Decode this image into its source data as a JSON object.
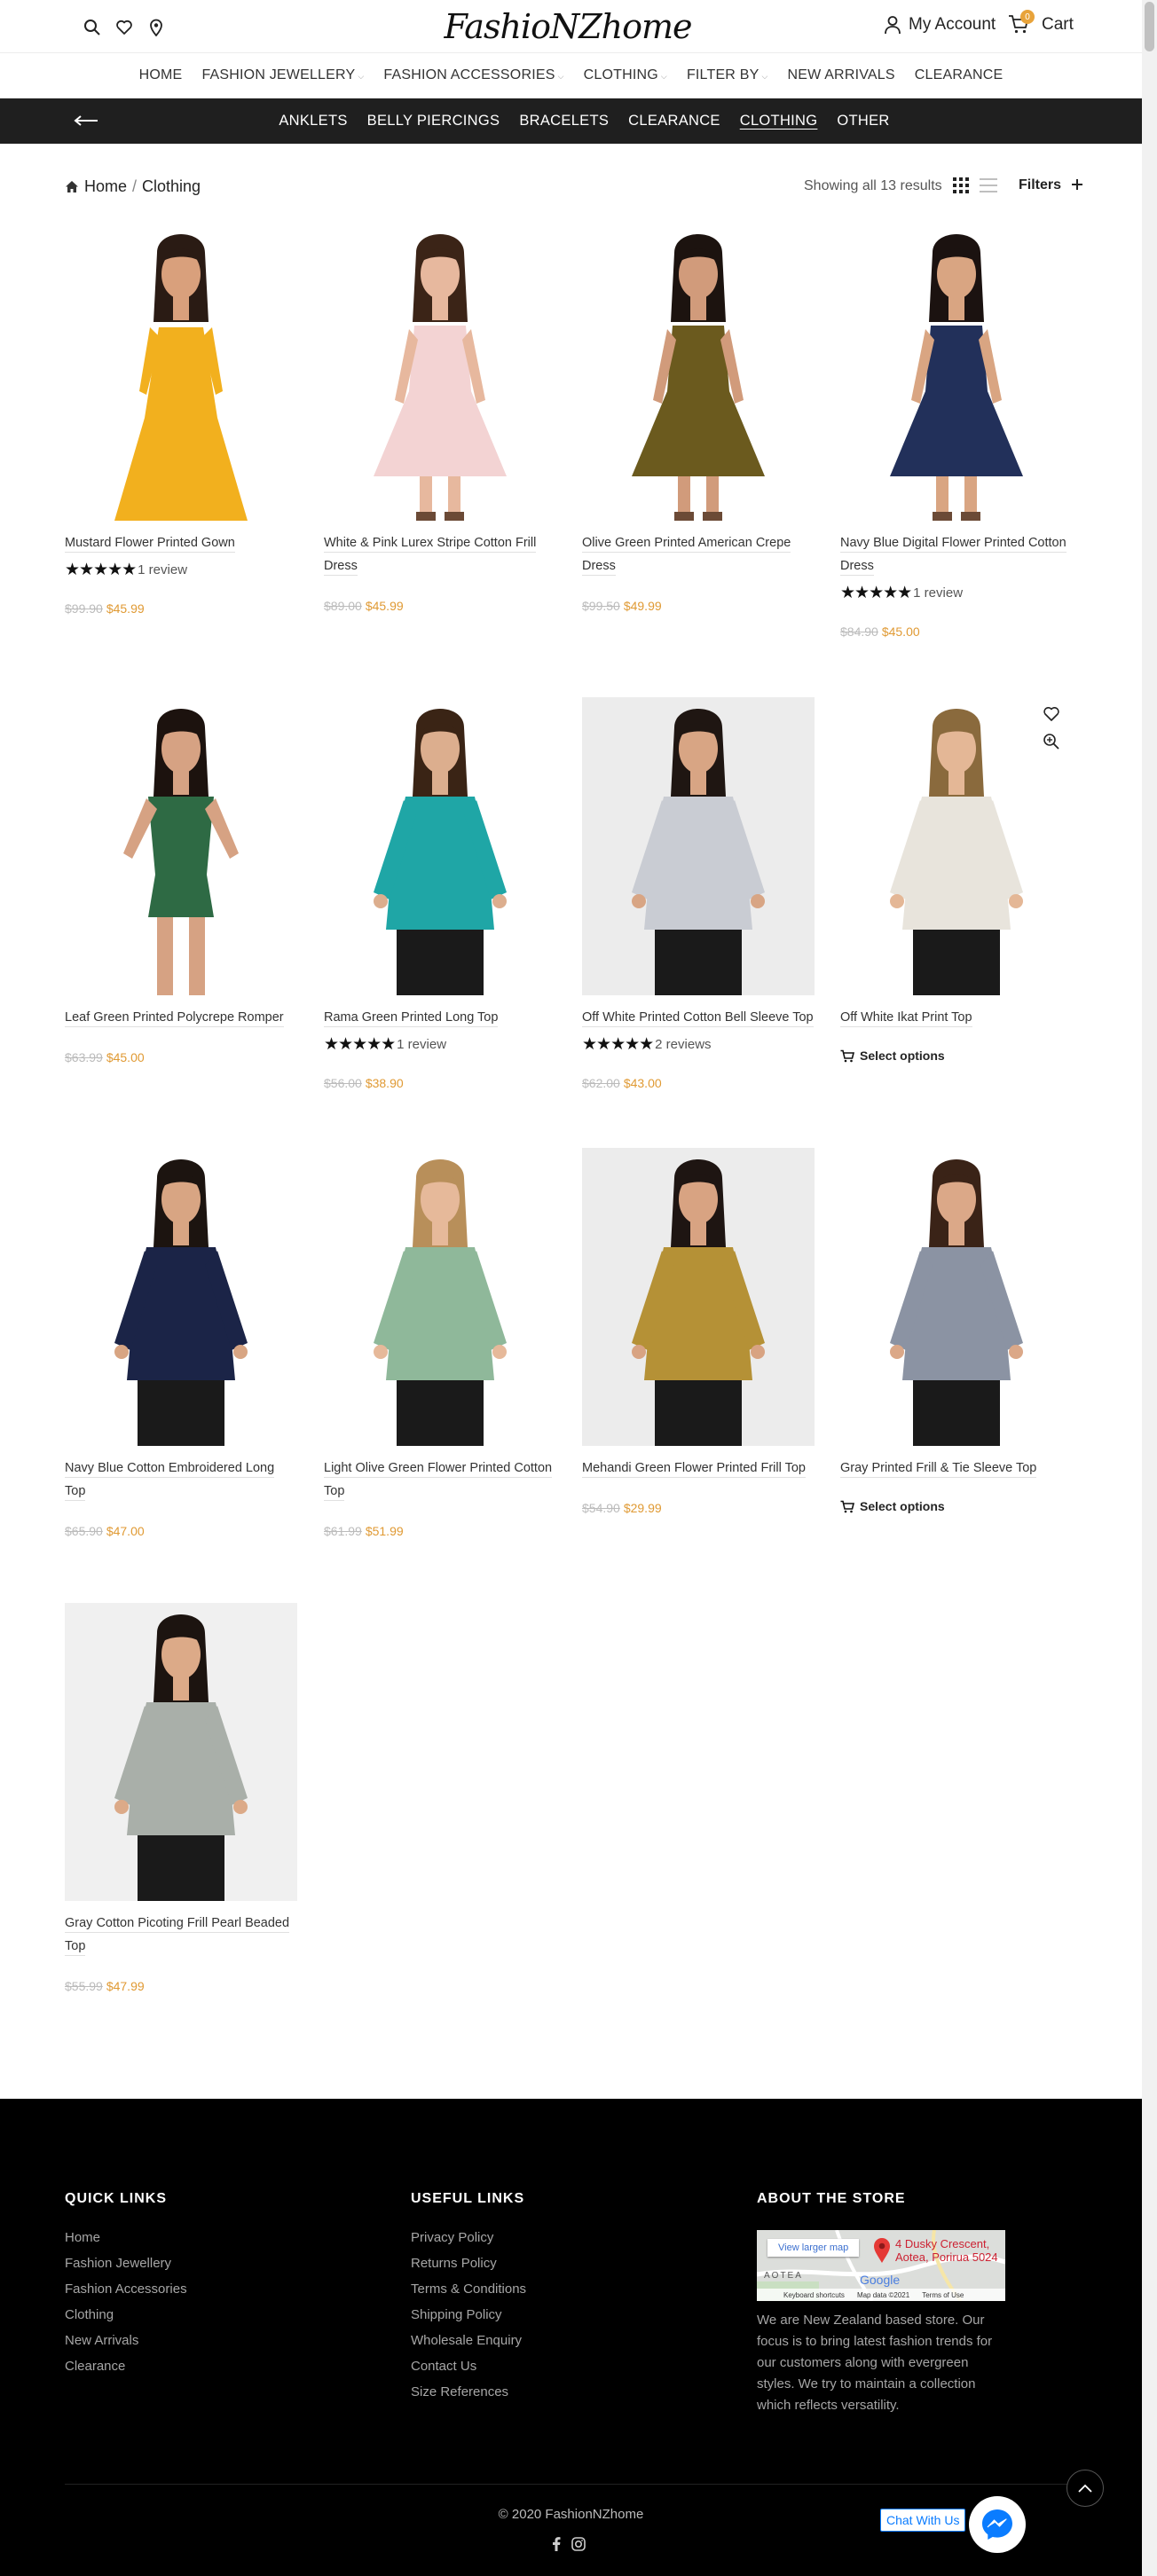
{
  "header": {
    "logo_text": "FashioNZhome",
    "account_label": "My Account",
    "cart_label": "Cart",
    "cart_count": "0"
  },
  "main_nav": [
    {
      "label": "HOME",
      "has_dropdown": false
    },
    {
      "label": "FASHION JEWELLERY",
      "has_dropdown": true
    },
    {
      "label": "FASHION ACCESSORIES",
      "has_dropdown": true
    },
    {
      "label": "CLOTHING",
      "has_dropdown": true
    },
    {
      "label": "FILTER BY",
      "has_dropdown": true
    },
    {
      "label": "NEW ARRIVALS",
      "has_dropdown": false
    },
    {
      "label": "CLEARANCE",
      "has_dropdown": false
    }
  ],
  "categories": [
    "ANKLETS",
    "BELLY PIERCINGS",
    "BRACELETS",
    "CLEARANCE",
    "CLOTHING",
    "OTHER"
  ],
  "active_category": "CLOTHING",
  "breadcrumb": {
    "home": "Home",
    "sep": "/",
    "current": "Clothing"
  },
  "toolbar": {
    "results": "Showing all 13 results",
    "filters": "Filters"
  },
  "products": [
    {
      "title": "Mustard Flower Printed Gown",
      "rating_text": "1 review",
      "old_price": "$99.90",
      "price": "$45.99",
      "bg": "#ffffff",
      "dress": "#f2b01e",
      "style": "gown",
      "skin": "#d9a07c",
      "hair": "#2a1b14"
    },
    {
      "title": "White & Pink Lurex Stripe Cotton Frill Dress",
      "rating_text": "",
      "old_price": "$89.00",
      "price": "$45.99",
      "bg": "#ffffff",
      "dress": "#f3d3d3",
      "style": "dress",
      "skin": "#e7b89e",
      "hair": "#3b2417"
    },
    {
      "title": "Olive Green Printed American Crepe Dress",
      "rating_text": "",
      "old_price": "$99.50",
      "price": "$49.99",
      "bg": "#ffffff",
      "dress": "#6b5a1e",
      "style": "dress",
      "skin": "#d19b7b",
      "hair": "#1c130f"
    },
    {
      "title": "Navy Blue Digital Flower Printed Cotton Dress",
      "rating_text": "1 review",
      "old_price": "$84.90",
      "price": "$45.00",
      "bg": "#ffffff",
      "dress": "#22305a",
      "style": "dress",
      "skin": "#d9a582",
      "hair": "#1b1210"
    },
    {
      "title": "Leaf Green Printed Polycrepe Romper",
      "rating_text": "",
      "old_price": "$63.99",
      "price": "$45.00",
      "bg": "#ffffff",
      "dress": "#2e6a44",
      "style": "romper",
      "skin": "#d6a283",
      "hair": "#1c120e"
    },
    {
      "title": "Rama Green Printed Long Top",
      "rating_text": "1 review",
      "old_price": "$56.00",
      "price": "$38.90",
      "bg": "#ffffff",
      "dress": "#1fa6a6",
      "style": "top",
      "skin": "#dcae8e",
      "hair": "#3a2415"
    },
    {
      "title": "Off White Printed Cotton Bell Sleeve Top",
      "rating_text": "2 reviews",
      "old_price": "$62.00",
      "price": "$43.00",
      "bg": "#ececec",
      "dress": "#c9ccd3",
      "style": "top",
      "skin": "#d8a584",
      "hair": "#1f1612"
    },
    {
      "title": "Off White Ikat Print Top",
      "rating_text": "",
      "old_price": "",
      "price": "",
      "select_options": "Select options",
      "bg": "#ffffff",
      "dress": "#e8e4dc",
      "style": "top",
      "skin": "#e4b796",
      "hair": "#8a6a3d"
    },
    {
      "title": "Navy Blue Cotton Embroidered Long Top",
      "rating_text": "",
      "old_price": "$65.90",
      "price": "$47.00",
      "bg": "#ffffff",
      "dress": "#1b2447",
      "style": "top",
      "skin": "#d8a583",
      "hair": "#1c1410"
    },
    {
      "title": "Light Olive Green Flower Printed Cotton Top",
      "rating_text": "",
      "old_price": "$61.99",
      "price": "$51.99",
      "bg": "#ffffff",
      "dress": "#8fb89a",
      "style": "top",
      "skin": "#e6b99a",
      "hair": "#b88f5a"
    },
    {
      "title": "Mehandi Green Flower Printed Frill Top",
      "rating_text": "",
      "old_price": "$54.90",
      "price": "$29.99",
      "bg": "#ececec",
      "dress": "#b59136",
      "style": "top",
      "skin": "#d8a382",
      "hair": "#1e1512"
    },
    {
      "title": "Gray Printed Frill & Tie Sleeve Top",
      "rating_text": "",
      "old_price": "",
      "price": "",
      "select_options": "Select options",
      "bg": "#ffffff",
      "dress": "#8b93a3",
      "style": "top",
      "skin": "#dba888",
      "hair": "#3a2317"
    },
    {
      "title": "Gray Cotton Picoting Frill Pearl Beaded Top",
      "rating_text": "",
      "old_price": "$55.99",
      "price": "$47.99",
      "bg": "#f0f0f0",
      "dress": "#a9afa9",
      "style": "top",
      "skin": "#dcaa88",
      "hair": "#1c1410"
    }
  ],
  "footer": {
    "quick_links_title": "QUICK LINKS",
    "quick_links": [
      "Home",
      "Fashion Jewellery",
      "Fashion Accessories",
      "Clothing",
      "New Arrivals",
      "Clearance"
    ],
    "useful_links_title": "USEFUL LINKS",
    "useful_links": [
      "Privacy Policy",
      "Returns Policy",
      "Terms & Conditions",
      "Shipping Policy",
      "Wholesale Enquiry",
      "Contact Us",
      "Size References"
    ],
    "about_title": "ABOUT THE STORE",
    "map": {
      "button": "View larger map",
      "address_line1": "4 Dusky Crescent,",
      "address_line2": "Aotea, Porirua 5024",
      "area_label": "AOTEA",
      "google": "Google",
      "shortcuts": "Keyboard shortcuts",
      "map_data": "Map data ©2021",
      "terms": "Terms of Use"
    },
    "about_text": "We are New Zealand based store. Our focus is to bring latest fashion trends for our customers along with evergreen styles. We try to maintain a collection which reflects versatility.",
    "copyright": "© 2020 FashionNZhome",
    "chat_label": "Chat With Us"
  },
  "colors": {
    "accent": "#e09a34",
    "dark_bar": "#1f1f1f",
    "footer_bg": "#000000",
    "messenger": "#0a7cff"
  }
}
